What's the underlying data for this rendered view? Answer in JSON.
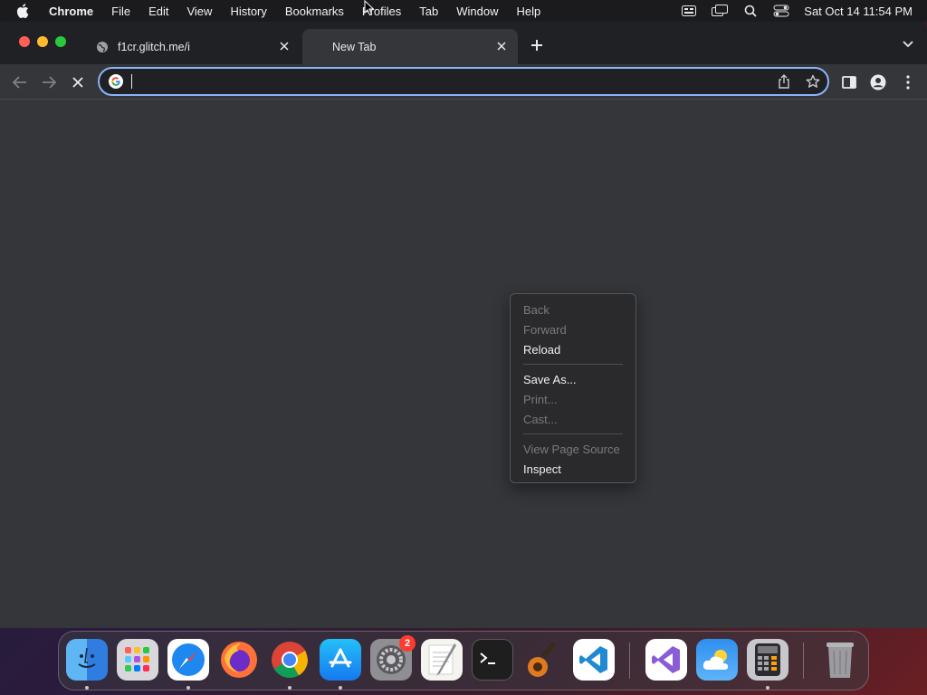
{
  "menubar": {
    "app_name": "Chrome",
    "items": [
      "File",
      "Edit",
      "View",
      "History",
      "Bookmarks",
      "Profiles",
      "Tab",
      "Window",
      "Help"
    ],
    "clock": "Sat Oct 14  11:54 PM"
  },
  "tabs": [
    {
      "title": "f1cr.glitch.me/i",
      "active": false
    },
    {
      "title": "New Tab",
      "active": true
    }
  ],
  "omnibox": {
    "value": "",
    "placeholder": ""
  },
  "context_menu": {
    "items": [
      {
        "label": "Back",
        "enabled": false
      },
      {
        "label": "Forward",
        "enabled": false
      },
      {
        "label": "Reload",
        "enabled": true
      },
      {
        "label": "Save As...",
        "enabled": true
      },
      {
        "label": "Print...",
        "enabled": false
      },
      {
        "label": "Cast...",
        "enabled": false
      },
      {
        "label": "View Page Source",
        "enabled": false
      },
      {
        "label": "Inspect",
        "enabled": true
      }
    ]
  },
  "dock": {
    "apps": [
      "finder",
      "launchpad",
      "safari",
      "firefox",
      "chrome",
      "app-store",
      "system-settings",
      "textedit",
      "terminal",
      "garageband",
      "vscode",
      "visual-studio",
      "weather",
      "calculator",
      "trash"
    ],
    "settings_badge": "2"
  },
  "colors": {
    "accent": "#8ab4f8",
    "window_bg": "#35363a",
    "tabstrip_bg": "#202124"
  }
}
